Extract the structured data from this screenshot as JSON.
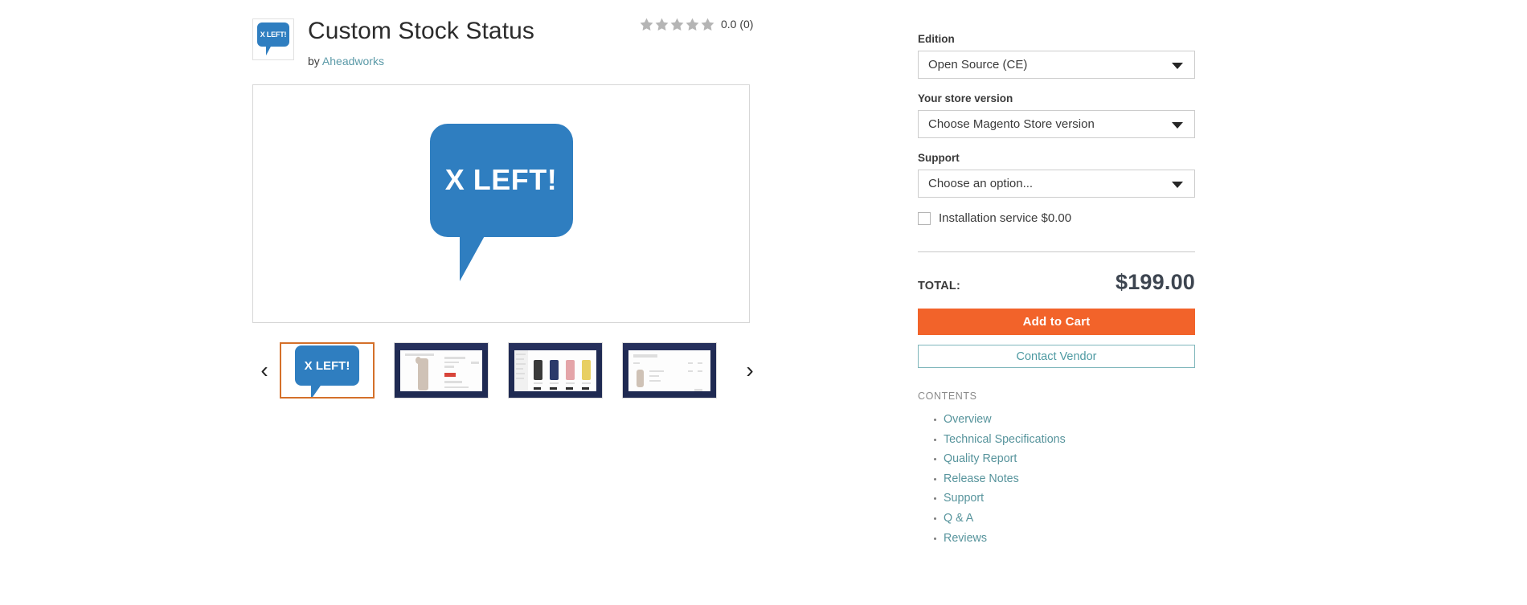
{
  "product": {
    "title": "Custom Stock Status",
    "by_prefix": "by",
    "vendor": "Aheadworks",
    "logo_text": "X LEFT!",
    "rating_value": "0.0",
    "rating_count": "(0)",
    "rating_text": "0.0 (0)",
    "stars_filled": 0,
    "stars_total": 5,
    "star_color": "#b5b5b5"
  },
  "gallery": {
    "prev_label": "‹",
    "next_label": "›",
    "active_index": 0,
    "thumbnails": [
      {
        "name": "product-logo",
        "type": "logo",
        "label": "X LEFT!"
      },
      {
        "name": "screenshot-product-page",
        "type": "screenshot",
        "label": ""
      },
      {
        "name": "screenshot-category-grid",
        "type": "screenshot",
        "label": ""
      },
      {
        "name": "screenshot-shopping-cart",
        "type": "screenshot",
        "label": ""
      }
    ]
  },
  "options": {
    "edition": {
      "label": "Edition",
      "value": "Open Source (CE)"
    },
    "store_version": {
      "label": "Your store version",
      "value": "Choose Magento Store version"
    },
    "support": {
      "label": "Support",
      "value": "Choose an option..."
    },
    "installation": {
      "label": "Installation service $0.00",
      "checked": false
    }
  },
  "pricing": {
    "total_label": "TOTAL:",
    "total_value": "$199.00",
    "add_to_cart_label": "Add to Cart",
    "contact_vendor_label": "Contact Vendor"
  },
  "contents": {
    "title": "CONTENTS",
    "links": [
      {
        "label": "Overview"
      },
      {
        "label": "Technical Specifications"
      },
      {
        "label": "Quality Report"
      },
      {
        "label": "Release Notes"
      },
      {
        "label": "Support"
      },
      {
        "label": "Q & A"
      },
      {
        "label": "Reviews"
      }
    ]
  },
  "colors": {
    "brand_blue": "#2f7ec0",
    "cart_orange": "#f2632a",
    "link_teal": "#57949c",
    "active_thumb_border": "#d4702a"
  }
}
